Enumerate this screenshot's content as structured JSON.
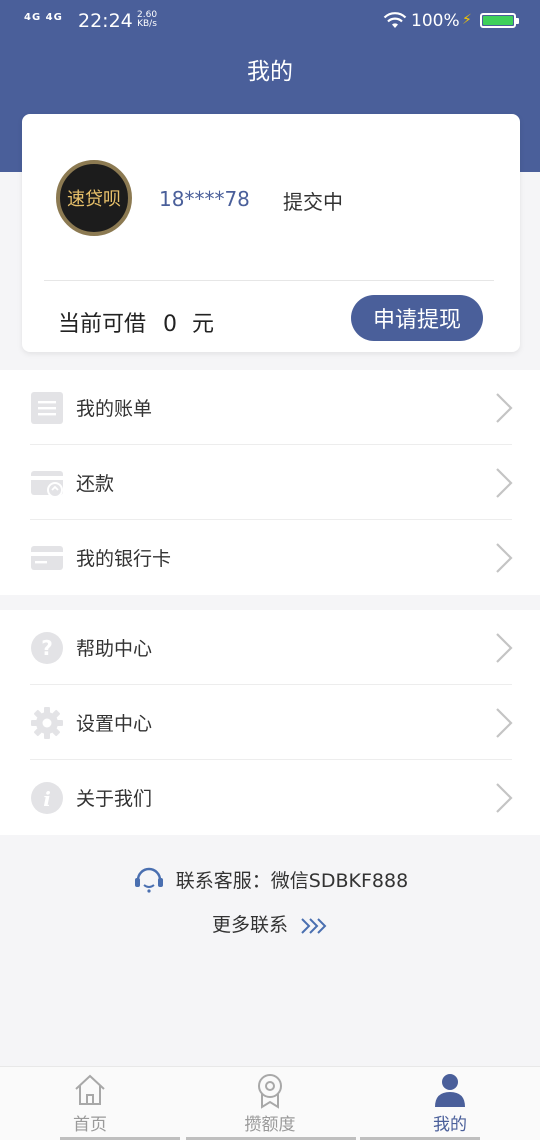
{
  "status_bar": {
    "network": "4G 4G",
    "time": "22:24",
    "speed_value": "2.60",
    "speed_unit": "KB/s",
    "battery": "100%"
  },
  "header": {
    "title": "我的"
  },
  "profile": {
    "avatar_text": "速贷呗",
    "phone": "18****78",
    "status": "提交中",
    "borrow_label": "当前可借",
    "borrow_amount": "0",
    "borrow_unit": "元",
    "apply_button": "申请提现"
  },
  "menu_group_1": [
    {
      "label": "我的账单",
      "icon": "bill-icon"
    },
    {
      "label": "还款",
      "icon": "repay-icon"
    },
    {
      "label": "我的银行卡",
      "icon": "bank-card-icon"
    }
  ],
  "menu_group_2": [
    {
      "label": "帮助中心",
      "icon": "help-icon"
    },
    {
      "label": "设置中心",
      "icon": "settings-icon"
    },
    {
      "label": "关于我们",
      "icon": "info-icon"
    }
  ],
  "contact": {
    "customer_service": "联系客服：微信SDBKF888",
    "more": "更多联系"
  },
  "tabs": [
    {
      "label": "首页",
      "icon": "home-icon",
      "active": false
    },
    {
      "label": "攒额度",
      "icon": "badge-icon",
      "active": false
    },
    {
      "label": "我的",
      "icon": "user-icon",
      "active": true
    }
  ],
  "colors": {
    "primary": "#4a5f9a",
    "avatar_gold": "#e8c16a",
    "battery_green": "#3ed05a"
  }
}
